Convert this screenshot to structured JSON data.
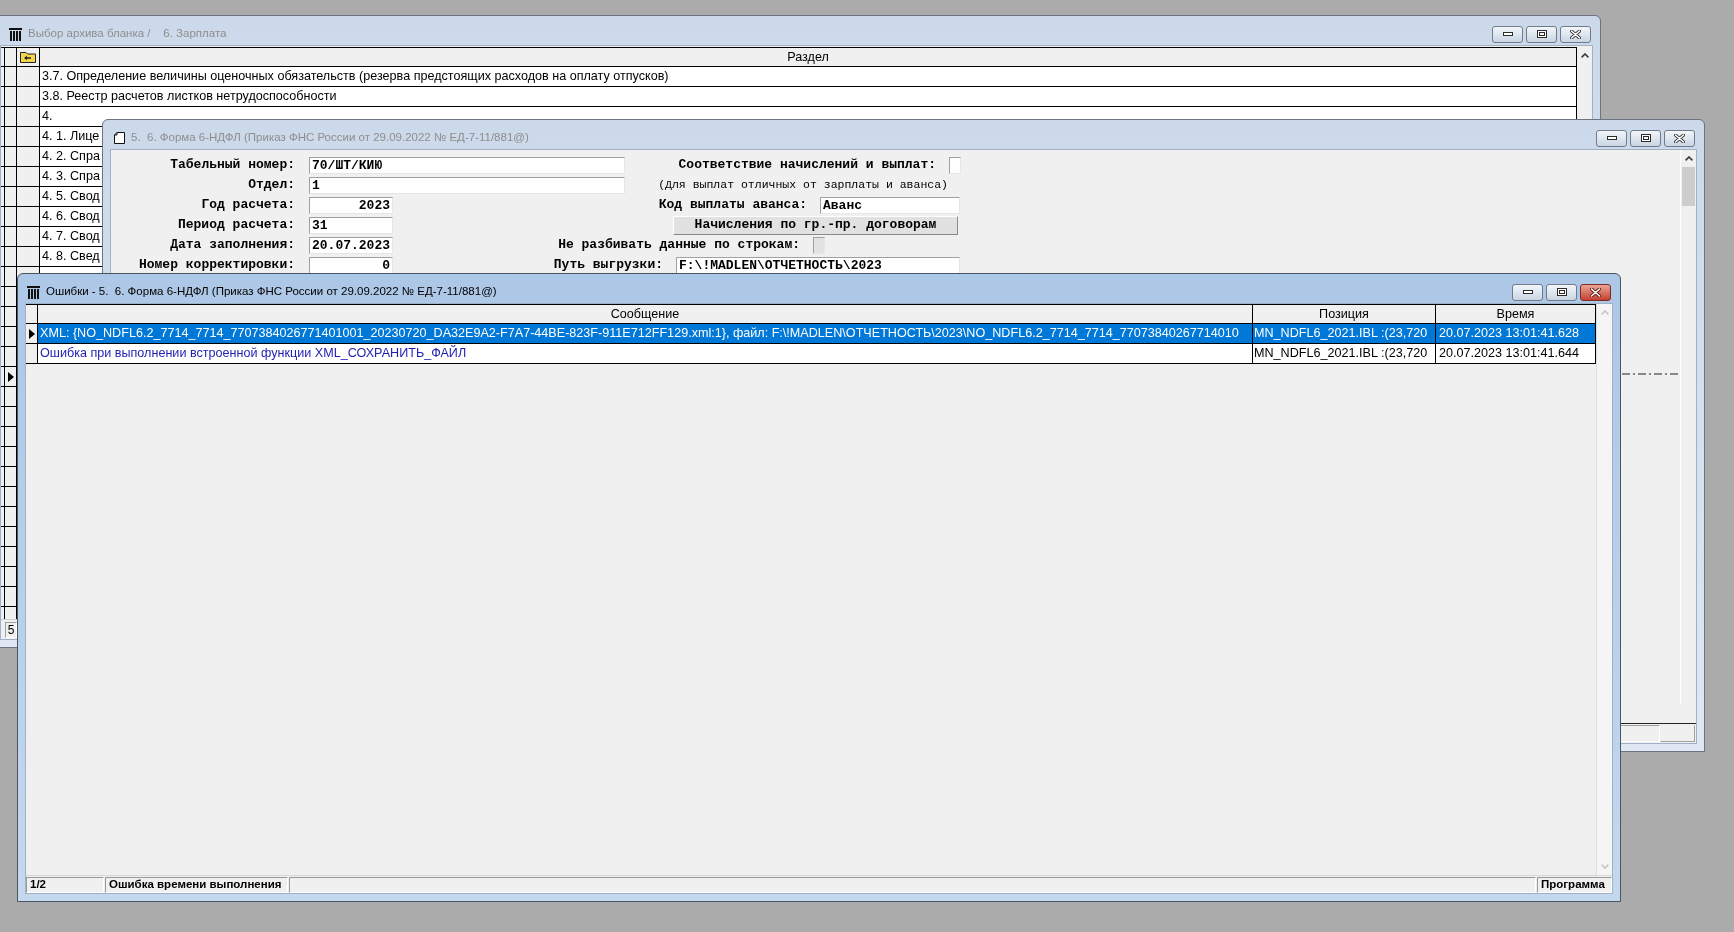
{
  "archive_window": {
    "title": "Выбор архива бланка /    6. Зарплата",
    "active": false,
    "columns": [
      "Раздел"
    ],
    "rows": [
      {
        "kind": "item",
        "text": "3.7. Определение величины оценочных обязательств (резерва предстоящих расходов на оплату отпусков)",
        "selected": false
      },
      {
        "kind": "item",
        "text": "3.8. Реестр расчетов листков нетрудоспособности",
        "selected": false
      },
      {
        "kind": "item",
        "text": "4.",
        "selected": false
      },
      {
        "kind": "item",
        "text": "4. 1. Лице",
        "selected": false
      },
      {
        "kind": "item",
        "text": "4. 2. Спра",
        "selected": false
      },
      {
        "kind": "item",
        "text": "4. 3. Спра",
        "selected": false
      },
      {
        "kind": "item",
        "text": "4. 5. Свод",
        "selected": false
      },
      {
        "kind": "item",
        "text": "4. 6. Свод",
        "selected": false
      },
      {
        "kind": "item",
        "text": "4. 7. Свод",
        "selected": false
      },
      {
        "kind": "item",
        "text": "4. 8. Свед",
        "selected": false
      },
      {
        "kind": "covered",
        "selected": false
      },
      {
        "kind": "covered",
        "selected": false
      },
      {
        "kind": "covered",
        "selected": false
      },
      {
        "kind": "covered",
        "selected": false
      },
      {
        "kind": "covered",
        "selected": false
      },
      {
        "kind": "covered",
        "selected": true
      },
      {
        "kind": "covered",
        "selected": false
      },
      {
        "kind": "covered",
        "selected": false
      },
      {
        "kind": "covered",
        "selected": false
      },
      {
        "kind": "covered",
        "selected": false
      },
      {
        "kind": "covered",
        "selected": false
      },
      {
        "kind": "covered",
        "selected": false
      },
      {
        "kind": "covered",
        "selected": false
      },
      {
        "kind": "covered",
        "selected": false
      },
      {
        "kind": "covered",
        "selected": false
      },
      {
        "kind": "covered",
        "selected": false
      },
      {
        "kind": "covered",
        "selected": false
      },
      {
        "kind": "covered",
        "selected": false
      }
    ],
    "status": "5"
  },
  "form_window": {
    "title": "5.  6. Форма 6-НДФЛ (Приказ ФНС России от 29.09.2022 № ЕД-7-11/881@)",
    "active": false,
    "fields": [
      {
        "label": "Табельный номер:",
        "value": "70/ШТ/КИЮ",
        "kind": "text"
      },
      {
        "label": "Отдел:",
        "value": "1",
        "kind": "text"
      },
      {
        "label": "Год расчета:",
        "value": "2023",
        "kind": "number"
      },
      {
        "label": "Период расчета:",
        "value": "31",
        "kind": "short_text"
      },
      {
        "label": "Дата заполнения:",
        "value": "20.07.2023",
        "kind": "short_text"
      },
      {
        "label": "Номер корректировки:",
        "value": "0",
        "kind": "number"
      }
    ],
    "options": [
      {
        "kind": "checkbox",
        "label": "Соответствие начислений и выплат:",
        "checked": false,
        "disabled": false
      },
      {
        "kind": "note",
        "text": "(Для выплат отличных от зарплаты и аванса)"
      },
      {
        "kind": "field",
        "label": "Код выплаты аванса:",
        "value": "Аванс"
      },
      {
        "kind": "button",
        "label": "Начисления по гр.-пр. договорам"
      },
      {
        "kind": "checkbox",
        "label": "Не разбивать данные по строкам:",
        "checked": false,
        "disabled": true
      },
      {
        "kind": "field",
        "label": "Путь выгрузки:",
        "value": "F:\\!MADLEN\\ОТЧЕТНОСТЬ\\2023"
      }
    ]
  },
  "errors_window": {
    "title": "Ошибки - 5.  6. Форма 6-НДФЛ (Приказ ФНС России от 29.09.2022 № ЕД-7-11/881@)",
    "active": true,
    "columns": [
      "Сообщение",
      "Позиция",
      "Время"
    ],
    "rows": [
      {
        "message": "XML: {NO_NDFL6.2_7714_7714_7707384026771401001_20230720_DA32E9A2-F7A7-44BE-823F-911E712FF129.xml:1}, файл: F:\\!MADLEN\\ОТЧЕТНОСТЬ\\2023\\NO_NDFL6.2_7714_7714_77073840267714010",
        "position": "MN_NDFL6_2021.IBL :(23,720",
        "time": "20.07.2023 13:01:41.628",
        "selected": true
      },
      {
        "message": "Ошибка при выполнении встроенной функции XML_СОХРАНИТЬ_ФАЙЛ",
        "position": "MN_NDFL6_2021.IBL :(23,720",
        "time": "20.07.2023 13:01:41.644",
        "selected": false,
        "color": "#1e1eb4"
      }
    ],
    "status_bar": [
      "1/2",
      "Ошибка времени выполнения",
      "Программа"
    ]
  }
}
